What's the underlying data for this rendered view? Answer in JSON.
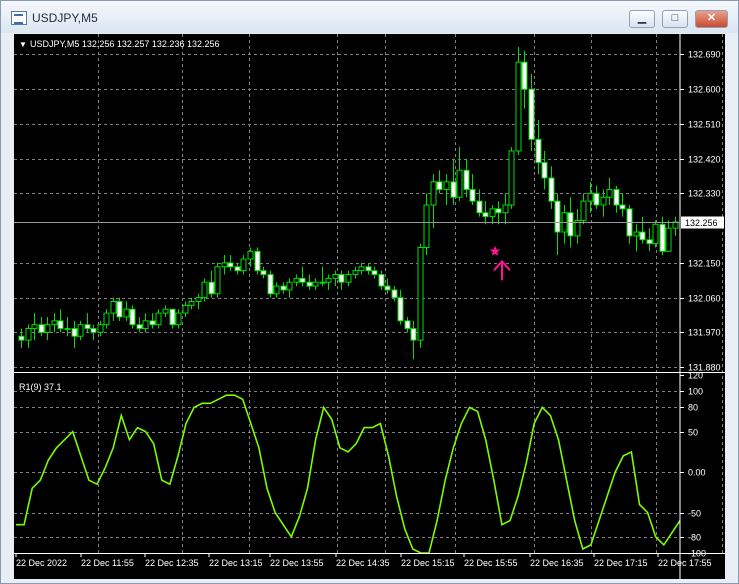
{
  "window": {
    "title": "USDJPY,M5",
    "buttons": {
      "minimize": "▁",
      "maximize": "□",
      "close": "✕"
    }
  },
  "chart": {
    "header": "USDJPY,M5  132.256 132.257 132.236 132.256",
    "header_arrow": "▼",
    "current_price_label": "132.256",
    "price_ticks": [
      "132.690",
      "132.600",
      "132.510",
      "132.420",
      "132.330",
      "132.150",
      "132.060",
      "131.970",
      "131.880"
    ],
    "indicator_label": "R1(9) 37.1",
    "indicator_ticks": [
      "120",
      "100",
      "80",
      "50",
      "0.00",
      "-50",
      "-80",
      "-100"
    ],
    "time_labels": [
      "22 Dec 2022",
      "22 Dec 11:55",
      "22 Dec 12:35",
      "22 Dec 13:15",
      "22 Dec 13:55",
      "22 Dec 14:35",
      "22 Dec 15:15",
      "22 Dec 15:55",
      "22 Dec 16:35",
      "22 Dec 17:15",
      "22 Dec 17:55"
    ],
    "colors": {
      "background": "#000000",
      "candle_up": "#000000",
      "candle_down": "#ffffff",
      "wick": "#00dd00",
      "grid": "#7f7f7f",
      "indicator_line": "#7cfc00",
      "signal_marker": "#ff1493"
    },
    "signal": {
      "icon": "star-arrow-icon",
      "price": 132.18
    }
  },
  "chart_data": {
    "type": "candlestick",
    "price_range": [
      131.87,
      132.73
    ],
    "candles": [
      [
        131.96,
        131.98,
        131.93,
        131.95
      ],
      [
        131.95,
        131.99,
        131.93,
        131.98
      ],
      [
        131.98,
        132.02,
        131.95,
        131.99
      ],
      [
        131.99,
        132.01,
        131.96,
        131.97
      ],
      [
        131.97,
        132.01,
        131.95,
        131.99
      ],
      [
        131.99,
        132.02,
        131.97,
        132.0
      ],
      [
        132.0,
        132.03,
        131.97,
        131.98
      ],
      [
        131.98,
        132.01,
        131.96,
        131.98
      ],
      [
        131.98,
        132.0,
        131.93,
        131.96
      ],
      [
        131.96,
        132.0,
        131.95,
        131.99
      ],
      [
        131.99,
        132.02,
        131.97,
        131.98
      ],
      [
        131.98,
        131.99,
        131.95,
        131.97
      ],
      [
        131.97,
        132.0,
        131.96,
        131.99
      ],
      [
        131.99,
        132.03,
        131.98,
        132.02
      ],
      [
        132.02,
        132.06,
        132.0,
        132.05
      ],
      [
        132.05,
        132.06,
        132.0,
        132.01
      ],
      [
        132.01,
        132.05,
        132.0,
        132.03
      ],
      [
        132.03,
        132.04,
        131.98,
        131.99
      ],
      [
        131.99,
        132.01,
        131.97,
        131.98
      ],
      [
        131.98,
        132.02,
        131.97,
        132.0
      ],
      [
        132.0,
        132.02,
        131.98,
        131.99
      ],
      [
        131.99,
        132.03,
        131.98,
        132.02
      ],
      [
        132.02,
        132.04,
        132.01,
        132.03
      ],
      [
        132.03,
        132.03,
        131.98,
        131.99
      ],
      [
        131.99,
        132.03,
        131.98,
        132.02
      ],
      [
        132.02,
        132.05,
        132.01,
        132.04
      ],
      [
        132.04,
        132.06,
        132.03,
        132.05
      ],
      [
        132.05,
        132.07,
        132.03,
        132.06
      ],
      [
        132.06,
        132.11,
        132.05,
        132.1
      ],
      [
        132.1,
        132.13,
        132.06,
        132.07
      ],
      [
        132.07,
        132.15,
        132.06,
        132.14
      ],
      [
        132.14,
        132.17,
        132.12,
        132.15
      ],
      [
        132.15,
        132.17,
        132.13,
        132.14
      ],
      [
        132.14,
        132.15,
        132.12,
        132.13
      ],
      [
        132.13,
        132.17,
        132.12,
        132.16
      ],
      [
        132.16,
        132.19,
        132.14,
        132.18
      ],
      [
        132.18,
        132.19,
        132.12,
        132.13
      ],
      [
        132.13,
        132.14,
        132.11,
        132.12
      ],
      [
        132.12,
        132.13,
        132.06,
        132.07
      ],
      [
        132.07,
        132.1,
        132.06,
        132.09
      ],
      [
        132.09,
        132.1,
        132.07,
        132.08
      ],
      [
        132.08,
        132.11,
        132.06,
        132.1
      ],
      [
        132.1,
        132.12,
        132.09,
        132.11
      ],
      [
        132.11,
        132.14,
        132.09,
        132.1
      ],
      [
        132.1,
        132.12,
        132.08,
        132.09
      ],
      [
        132.09,
        132.11,
        132.08,
        132.1
      ],
      [
        132.1,
        132.14,
        132.09,
        132.1
      ],
      [
        132.1,
        132.12,
        132.08,
        132.11
      ],
      [
        132.11,
        132.13,
        132.09,
        132.12
      ],
      [
        132.12,
        132.13,
        132.08,
        132.1
      ],
      [
        132.1,
        132.13,
        132.09,
        132.12
      ],
      [
        132.12,
        132.14,
        132.11,
        132.13
      ],
      [
        132.13,
        132.15,
        132.12,
        132.14
      ],
      [
        132.14,
        132.15,
        132.12,
        132.13
      ],
      [
        132.13,
        132.14,
        132.11,
        132.12
      ],
      [
        132.12,
        132.13,
        132.08,
        132.09
      ],
      [
        132.09,
        132.11,
        132.07,
        132.08
      ],
      [
        132.08,
        132.09,
        132.05,
        132.06
      ],
      [
        132.06,
        132.08,
        131.99,
        132.0
      ],
      [
        132.0,
        132.01,
        131.97,
        131.98
      ],
      [
        131.98,
        132.0,
        131.9,
        131.95
      ],
      [
        131.95,
        132.2,
        131.93,
        132.19
      ],
      [
        132.19,
        132.33,
        132.17,
        132.3
      ],
      [
        132.3,
        132.38,
        132.24,
        132.36
      ],
      [
        132.36,
        132.39,
        132.33,
        132.34
      ],
      [
        132.34,
        132.38,
        132.3,
        132.36
      ],
      [
        132.36,
        132.42,
        132.3,
        132.32
      ],
      [
        132.32,
        132.45,
        132.31,
        132.39
      ],
      [
        132.39,
        132.42,
        132.32,
        132.34
      ],
      [
        132.34,
        132.38,
        132.3,
        132.31
      ],
      [
        132.31,
        132.34,
        132.27,
        132.28
      ],
      [
        132.28,
        132.31,
        132.25,
        132.27
      ],
      [
        132.27,
        132.3,
        132.25,
        132.29
      ],
      [
        132.29,
        132.31,
        132.25,
        132.28
      ],
      [
        132.28,
        132.33,
        132.25,
        132.3
      ],
      [
        132.3,
        132.45,
        132.29,
        132.44
      ],
      [
        132.44,
        132.71,
        132.43,
        132.67
      ],
      [
        132.67,
        132.7,
        132.55,
        132.6
      ],
      [
        132.6,
        132.64,
        132.44,
        132.47
      ],
      [
        132.47,
        132.52,
        132.38,
        132.41
      ],
      [
        132.41,
        132.44,
        132.34,
        132.37
      ],
      [
        132.37,
        132.4,
        132.29,
        132.31
      ],
      [
        132.31,
        132.33,
        132.17,
        132.23
      ],
      [
        132.23,
        132.3,
        132.2,
        132.28
      ],
      [
        132.28,
        132.32,
        132.19,
        132.22
      ],
      [
        132.22,
        132.29,
        132.2,
        132.26
      ],
      [
        132.26,
        132.33,
        132.25,
        132.31
      ],
      [
        132.31,
        132.36,
        132.28,
        132.33
      ],
      [
        132.33,
        132.35,
        132.29,
        132.3
      ],
      [
        132.3,
        132.34,
        132.27,
        132.32
      ],
      [
        132.32,
        132.37,
        132.3,
        132.34
      ],
      [
        132.34,
        132.35,
        132.28,
        132.3
      ],
      [
        132.3,
        132.33,
        132.27,
        132.29
      ],
      [
        132.29,
        132.3,
        132.2,
        132.22
      ],
      [
        132.22,
        132.25,
        132.18,
        132.23
      ],
      [
        132.23,
        132.27,
        132.2,
        132.21
      ],
      [
        132.21,
        132.24,
        132.18,
        132.2
      ],
      [
        132.2,
        132.26,
        132.19,
        132.25
      ],
      [
        132.25,
        132.27,
        132.17,
        132.18
      ],
      [
        132.18,
        132.26,
        132.18,
        132.24
      ],
      [
        132.24,
        132.27,
        132.22,
        132.256
      ]
    ],
    "indicator": {
      "name": "R1(9)",
      "range": [
        -100,
        120
      ],
      "values": [
        -65,
        -65,
        -20,
        -10,
        15,
        30,
        40,
        50,
        20,
        -10,
        -15,
        5,
        30,
        70,
        40,
        55,
        50,
        35,
        -10,
        -15,
        20,
        60,
        80,
        85,
        85,
        90,
        95,
        95,
        90,
        60,
        30,
        -20,
        -50,
        -65,
        -80,
        -55,
        -20,
        40,
        80,
        65,
        30,
        25,
        35,
        55,
        55,
        60,
        20,
        -30,
        -70,
        -95,
        -100,
        -100,
        -60,
        -10,
        30,
        60,
        80,
        75,
        40,
        -10,
        -65,
        -60,
        -30,
        10,
        60,
        80,
        70,
        40,
        -10,
        -60,
        -95,
        -90,
        -60,
        -30,
        0,
        20,
        25,
        -40,
        -50,
        -80,
        -90,
        -75,
        -60
      ]
    }
  }
}
